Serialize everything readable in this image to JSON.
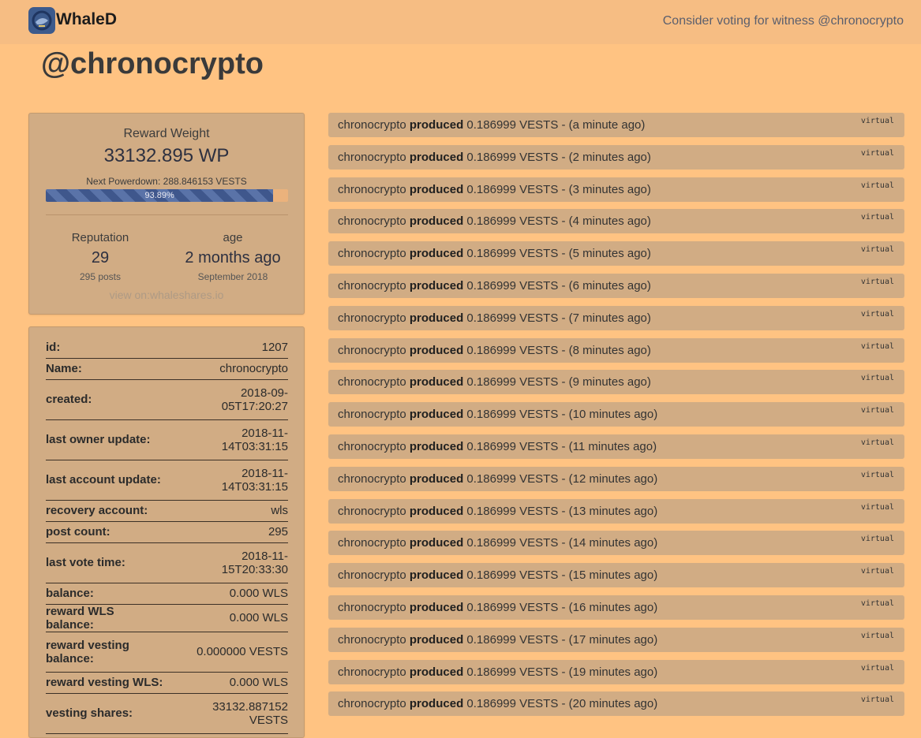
{
  "navbar": {
    "brand": "WhaleD",
    "witness_text": "Consider voting for witness @chronocrypto"
  },
  "page_title": "@chronocrypto",
  "summary": {
    "reward_weight_label": "Reward Weight",
    "reward_weight_value": "33132.895 WP",
    "next_powerdown": "Next Powerdown: 288.846153 VESTS",
    "progress_label": "93.89%",
    "progress_fraction": 0.9389,
    "reputation_label": "Reputation",
    "reputation_value": "29",
    "posts": "295 posts",
    "age_label": "age",
    "age_value": "2 months ago",
    "age_date": "September 2018",
    "view_on": "view on:whaleshares.io"
  },
  "details": [
    {
      "key": "id:",
      "lines": [
        "1207"
      ]
    },
    {
      "key": "Name:",
      "lines": [
        "chronocrypto"
      ]
    },
    {
      "key": "created:",
      "lines": [
        "2018-09-",
        "05T17:20:27"
      ]
    },
    {
      "key": "last owner update:",
      "lines": [
        "2018-11-",
        "14T03:31:15"
      ]
    },
    {
      "key": "last account update:",
      "lines": [
        "2018-11-",
        "14T03:31:15"
      ]
    },
    {
      "key": "recovery account:",
      "lines": [
        "wls"
      ]
    },
    {
      "key": "post count:",
      "lines": [
        "295"
      ]
    },
    {
      "key": "last vote time:",
      "lines": [
        "2018-11-",
        "15T20:33:30"
      ]
    },
    {
      "key": "balance:",
      "lines": [
        "0.000 WLS"
      ]
    },
    {
      "key": "reward WLS balance:",
      "lines": [
        "0.000 WLS"
      ]
    },
    {
      "key_lines": [
        "reward vesting",
        "balance:"
      ],
      "lines": [
        "0.000000 VESTS"
      ]
    },
    {
      "key": "reward vesting WLS:",
      "lines": [
        "0.000 WLS"
      ]
    },
    {
      "key": "vesting shares:",
      "lines": [
        "33132.887152",
        "VESTS"
      ]
    }
  ],
  "operations": [
    {
      "account": "chronocrypto",
      "verb": "produced",
      "amount": "0.186999 VESTS",
      "time": "- (a minute ago)",
      "tag": "virtual"
    },
    {
      "account": "chronocrypto",
      "verb": "produced",
      "amount": "0.186999 VESTS",
      "time": "- (2 minutes ago)",
      "tag": "virtual"
    },
    {
      "account": "chronocrypto",
      "verb": "produced",
      "amount": "0.186999 VESTS",
      "time": "- (3 minutes ago)",
      "tag": "virtual"
    },
    {
      "account": "chronocrypto",
      "verb": "produced",
      "amount": "0.186999 VESTS",
      "time": "- (4 minutes ago)",
      "tag": "virtual"
    },
    {
      "account": "chronocrypto",
      "verb": "produced",
      "amount": "0.186999 VESTS",
      "time": "- (5 minutes ago)",
      "tag": "virtual"
    },
    {
      "account": "chronocrypto",
      "verb": "produced",
      "amount": "0.186999 VESTS",
      "time": "- (6 minutes ago)",
      "tag": "virtual"
    },
    {
      "account": "chronocrypto",
      "verb": "produced",
      "amount": "0.186999 VESTS",
      "time": "- (7 minutes ago)",
      "tag": "virtual"
    },
    {
      "account": "chronocrypto",
      "verb": "produced",
      "amount": "0.186999 VESTS",
      "time": "- (8 minutes ago)",
      "tag": "virtual"
    },
    {
      "account": "chronocrypto",
      "verb": "produced",
      "amount": "0.186999 VESTS",
      "time": "- (9 minutes ago)",
      "tag": "virtual"
    },
    {
      "account": "chronocrypto",
      "verb": "produced",
      "amount": "0.186999 VESTS",
      "time": "- (10 minutes ago)",
      "tag": "virtual"
    },
    {
      "account": "chronocrypto",
      "verb": "produced",
      "amount": "0.186999 VESTS",
      "time": "- (11 minutes ago)",
      "tag": "virtual"
    },
    {
      "account": "chronocrypto",
      "verb": "produced",
      "amount": "0.186999 VESTS",
      "time": "- (12 minutes ago)",
      "tag": "virtual"
    },
    {
      "account": "chronocrypto",
      "verb": "produced",
      "amount": "0.186999 VESTS",
      "time": "- (13 minutes ago)",
      "tag": "virtual"
    },
    {
      "account": "chronocrypto",
      "verb": "produced",
      "amount": "0.186999 VESTS",
      "time": "- (14 minutes ago)",
      "tag": "virtual"
    },
    {
      "account": "chronocrypto",
      "verb": "produced",
      "amount": "0.186999 VESTS",
      "time": "- (15 minutes ago)",
      "tag": "virtual"
    },
    {
      "account": "chronocrypto",
      "verb": "produced",
      "amount": "0.186999 VESTS",
      "time": "- (16 minutes ago)",
      "tag": "virtual"
    },
    {
      "account": "chronocrypto",
      "verb": "produced",
      "amount": "0.186999 VESTS",
      "time": "- (17 minutes ago)",
      "tag": "virtual"
    },
    {
      "account": "chronocrypto",
      "verb": "produced",
      "amount": "0.186999 VESTS",
      "time": "- (19 minutes ago)",
      "tag": "virtual"
    },
    {
      "account": "chronocrypto",
      "verb": "produced",
      "amount": "0.186999 VESTS",
      "time": "- (20 minutes ago)",
      "tag": "virtual"
    }
  ],
  "colors": {
    "page_bg": "#ffc382",
    "navbar_bg": "#f6bd83",
    "card_bg": "#d1ac84",
    "progress_fill": "#3f578c",
    "logo_bg": "#3c5a8c"
  },
  "icons": {
    "logo": "whale-logo-icon"
  }
}
